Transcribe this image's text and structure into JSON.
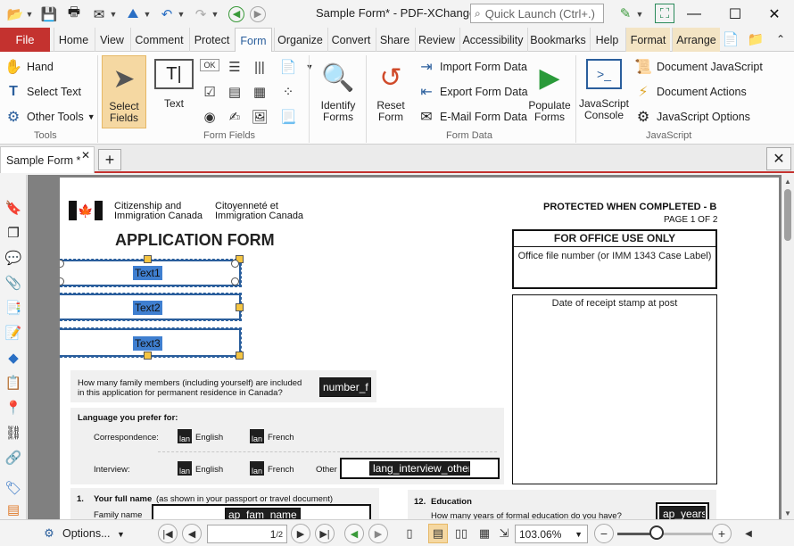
{
  "window": {
    "title": "Sample Form* - PDF-XChange ...",
    "quick_launch_placeholder": "Quick Launch (Ctrl+.)",
    "min": "—",
    "max": "☐",
    "close": "✕"
  },
  "menu": {
    "file": "File",
    "tabs": [
      "Home",
      "View",
      "Comment",
      "Protect",
      "Form",
      "Organize",
      "Convert",
      "Share",
      "Review",
      "Accessibility",
      "Bookmarks",
      "Help",
      "Format",
      "Arrange"
    ],
    "active": "Form"
  },
  "ribbon": {
    "tools": {
      "hand": "Hand",
      "select_text": "Select Text",
      "other_tools": "Other Tools",
      "label": "Tools"
    },
    "select_fields": "Select Fields",
    "text": "Text",
    "form_fields_label": "Form Fields",
    "identify_forms": "Identify Forms",
    "reset_form": "Reset Form",
    "import_form_data": "Import Form Data",
    "export_form_data": "Export Form Data",
    "email_form_data": "E-Mail Form Data",
    "populate_forms": "Populate Forms",
    "form_data_label": "Form Data",
    "javascript_console": "JavaScript Console",
    "document_javascript": "Document JavaScript",
    "document_actions": "Document Actions",
    "javascript_options": "JavaScript Options",
    "javascript_label": "JavaScript"
  },
  "doc_tab": {
    "name": "Sample Form *",
    "close": "✕",
    "new": "+"
  },
  "page": {
    "gov_en": [
      "Citizenship and",
      "Immigration Canada"
    ],
    "gov_fr": [
      "Citoyenneté et",
      "Immigration Canada"
    ],
    "protected": "PROTECTED WHEN COMPLETED - B",
    "page_of": "PAGE 1 OF 2",
    "app_title": "APPLICATION FORM",
    "office_use": "FOR OFFICE USE ONLY",
    "office_file": "Office file number (or IMM 1343 Case Label)",
    "receipt": "Date of receipt stamp at post",
    "fields": [
      "Text1",
      "Text2",
      "Text3"
    ],
    "family_q": [
      "How many family members (including yourself) are included",
      "in this application for permanent residence in Canada?"
    ],
    "number_field": "number_f",
    "lang_pref": "Language you prefer for:",
    "correspondence": "Correspondence:",
    "interview": "Interview:",
    "english": "English",
    "french": "French",
    "other": "Other",
    "chk_label": "lan",
    "lang_other_field": "lang_interview_other",
    "full_name_num": "1.",
    "full_name": "Your full name",
    "full_name_note": "(as shown in your passport or travel document)",
    "family_name": "Family name",
    "fam_name_field": "ap_fam_name",
    "education_num": "12.",
    "education": "Education",
    "edu_q": "How many years of formal education do you have?",
    "years_field": "ap_years"
  },
  "status": {
    "options": "Options...",
    "page_value": "1",
    "page_total": "2",
    "zoom": "103.06%",
    "zoom_fraction": 0.4
  }
}
